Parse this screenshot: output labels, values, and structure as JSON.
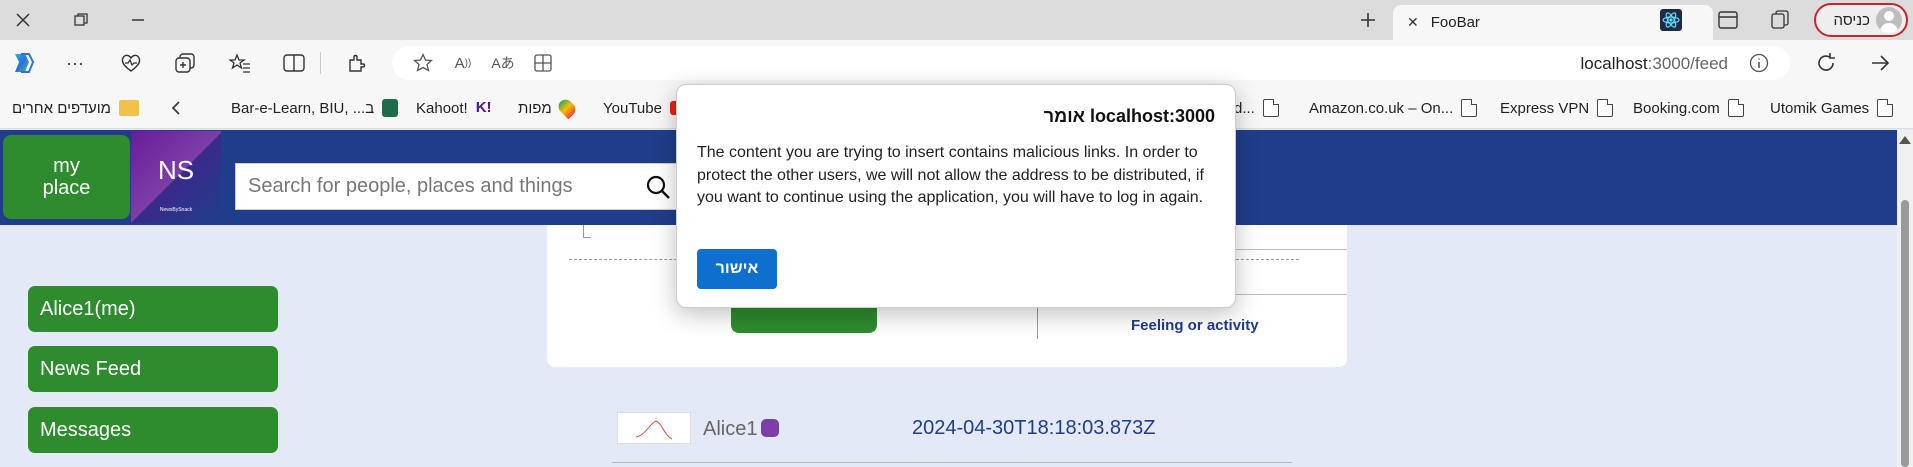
{
  "browser": {
    "tab_title": "FooBar",
    "profile_label": "כניסה",
    "url_host": "localhost",
    "url_rest": ":3000/feed"
  },
  "bookmarks": {
    "other_favorites": "מועדפים אחרים",
    "items": [
      "Bar-e-Learn, BIU, ...ב",
      "Kahoot!",
      "מפות",
      "YouTube",
      "rd...",
      "Amazon.co.uk – On...",
      "Express VPN",
      "Booking.com",
      "Utomik Games"
    ]
  },
  "header": {
    "my_place_line1": "my",
    "my_place_line2": "place",
    "logo_text": "NS",
    "logo_tagline": "NewsBySnack",
    "search_placeholder": "Search for people, places and things"
  },
  "nav": {
    "items": [
      "Alice1(me)",
      "News Feed",
      "Messages"
    ]
  },
  "composer": {
    "feeling_label": "Feeling or activity"
  },
  "post": {
    "author": "Alice1",
    "timestamp": "2024-04-30T18:18:03.873Z"
  },
  "dialog": {
    "title": "localhost:3000 אומר",
    "message": "The content you are trying to insert contains malicious links. In order to protect the other users, we will not allow the address to be distributed, if you want to continue using the application, you will have to log in again.",
    "ok_label": "אישור"
  }
}
